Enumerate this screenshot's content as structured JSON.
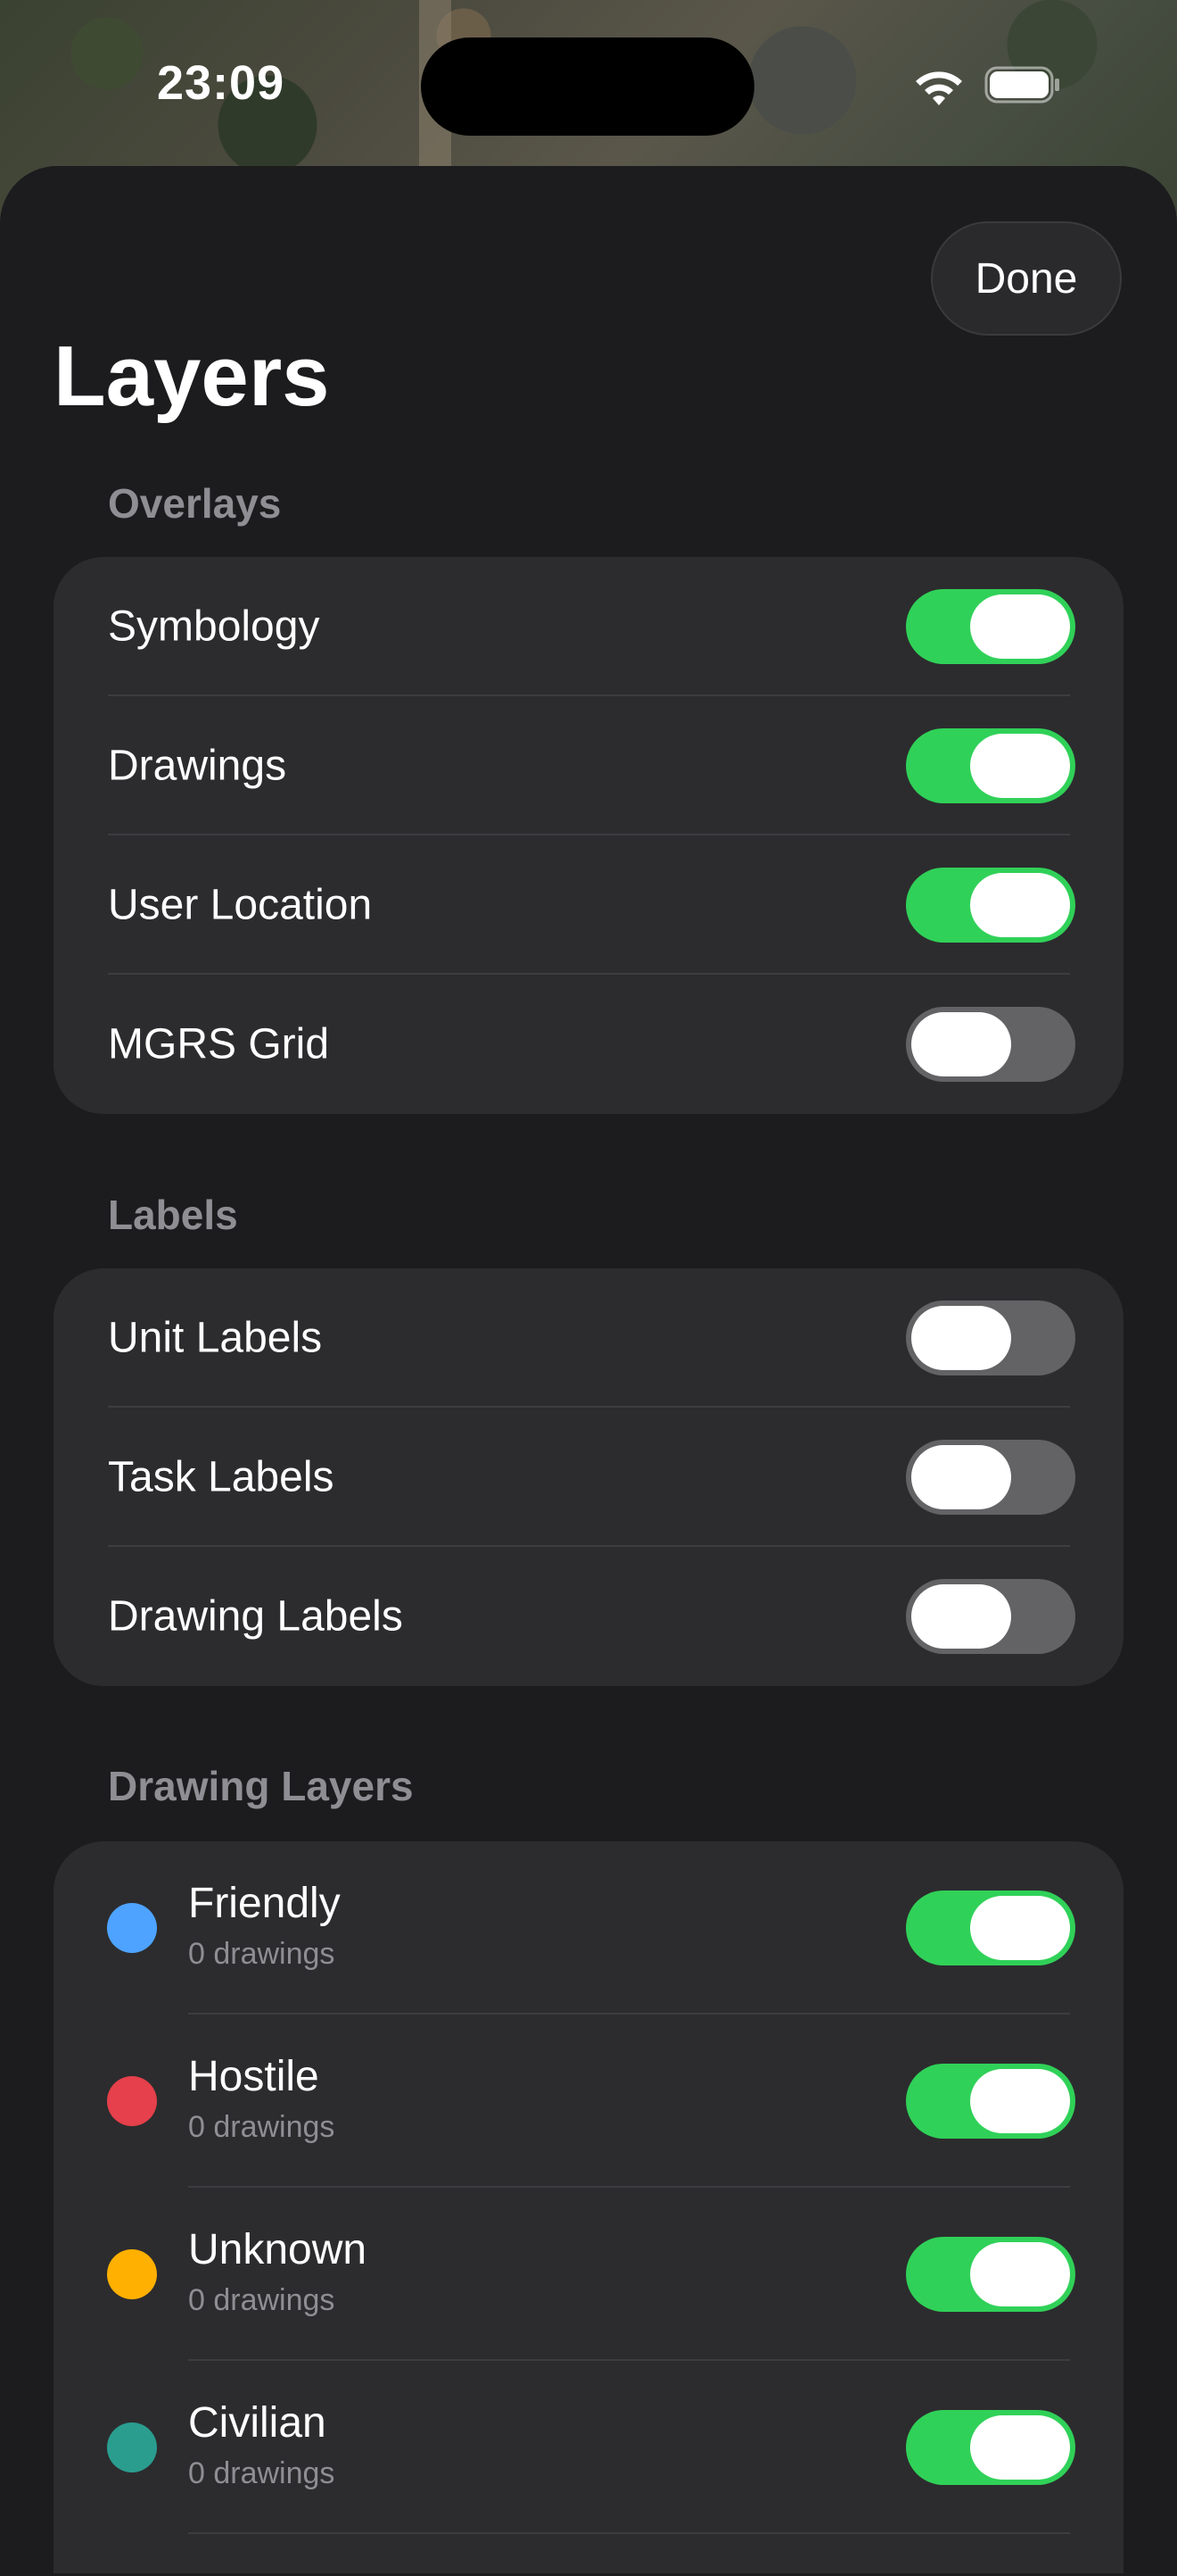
{
  "status_bar": {
    "time": "23:09"
  },
  "header": {
    "title": "Layers",
    "done_label": "Done"
  },
  "sections": {
    "overlays": {
      "header": "Overlays",
      "items": [
        {
          "label": "Symbology",
          "on": true
        },
        {
          "label": "Drawings",
          "on": true
        },
        {
          "label": "User Location",
          "on": true
        },
        {
          "label": "MGRS Grid",
          "on": false
        }
      ]
    },
    "labels": {
      "header": "Labels",
      "items": [
        {
          "label": "Unit Labels",
          "on": false
        },
        {
          "label": "Task Labels",
          "on": false
        },
        {
          "label": "Drawing Labels",
          "on": false
        }
      ]
    },
    "drawing_layers": {
      "header": "Drawing Layers",
      "items": [
        {
          "name": "Friendly",
          "count": "0 drawings",
          "color": "#4da3ff",
          "on": true
        },
        {
          "name": "Hostile",
          "count": "0 drawings",
          "color": "#e5404b",
          "on": true
        },
        {
          "name": "Unknown",
          "count": "0 drawings",
          "color": "#ffb000",
          "on": true
        },
        {
          "name": "Civilian",
          "count": "0 drawings",
          "color": "#2a9d8f",
          "on": true
        }
      ]
    }
  },
  "colors": {
    "toggle_on": "#30d158",
    "toggle_off": "#636366",
    "sheet_bg": "#1c1c1e",
    "group_bg": "#2c2c2e",
    "section_header": "#8e8e93"
  }
}
